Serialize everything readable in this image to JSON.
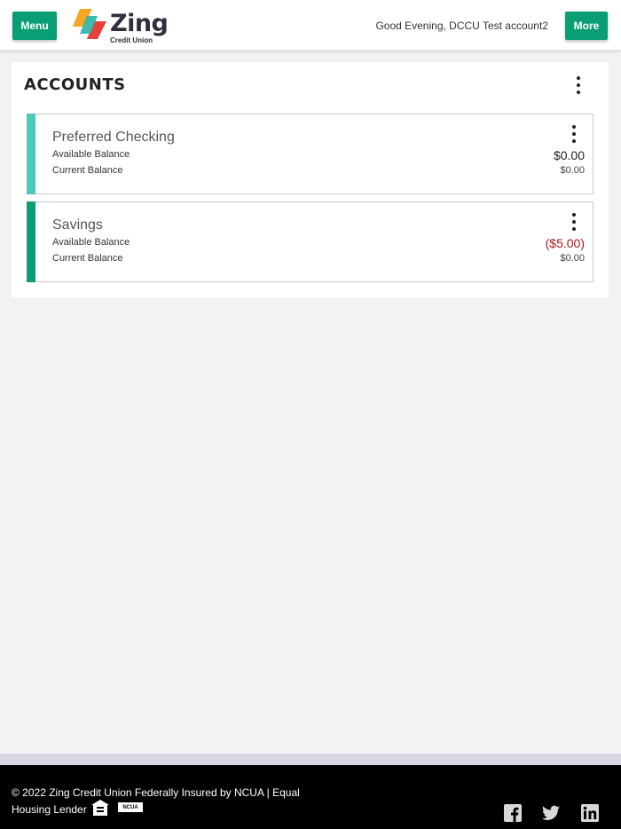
{
  "header": {
    "menu_label": "Menu",
    "more_label": "More",
    "greeting": "Good Evening, DCCU Test account2",
    "logo": {
      "name": "Zing",
      "subtitle": "Credit Union"
    }
  },
  "accounts": {
    "title": "ACCOUNTS",
    "items": [
      {
        "name": "Preferred Checking",
        "available_label": "Available Balance",
        "current_label": "Current Balance",
        "available": "$0.00",
        "current": "$0.00",
        "accent": "#4cc9b8"
      },
      {
        "name": "Savings",
        "available_label": "Available Balance",
        "current_label": "Current Balance",
        "available": "($5.00)",
        "current": "$0.00",
        "accent": "#0a9e74"
      }
    ]
  },
  "footer": {
    "line1": "© 2022 Zing Credit Union Federally Insured by NCUA | Equal",
    "line2": "Housing Lender",
    "ncua_badge": "NCUA",
    "social_icons": [
      "facebook-icon",
      "twitter-icon",
      "linkedin-icon"
    ]
  },
  "colors": {
    "brand_green": "#0a9e74",
    "negative_red": "#b0141c"
  }
}
